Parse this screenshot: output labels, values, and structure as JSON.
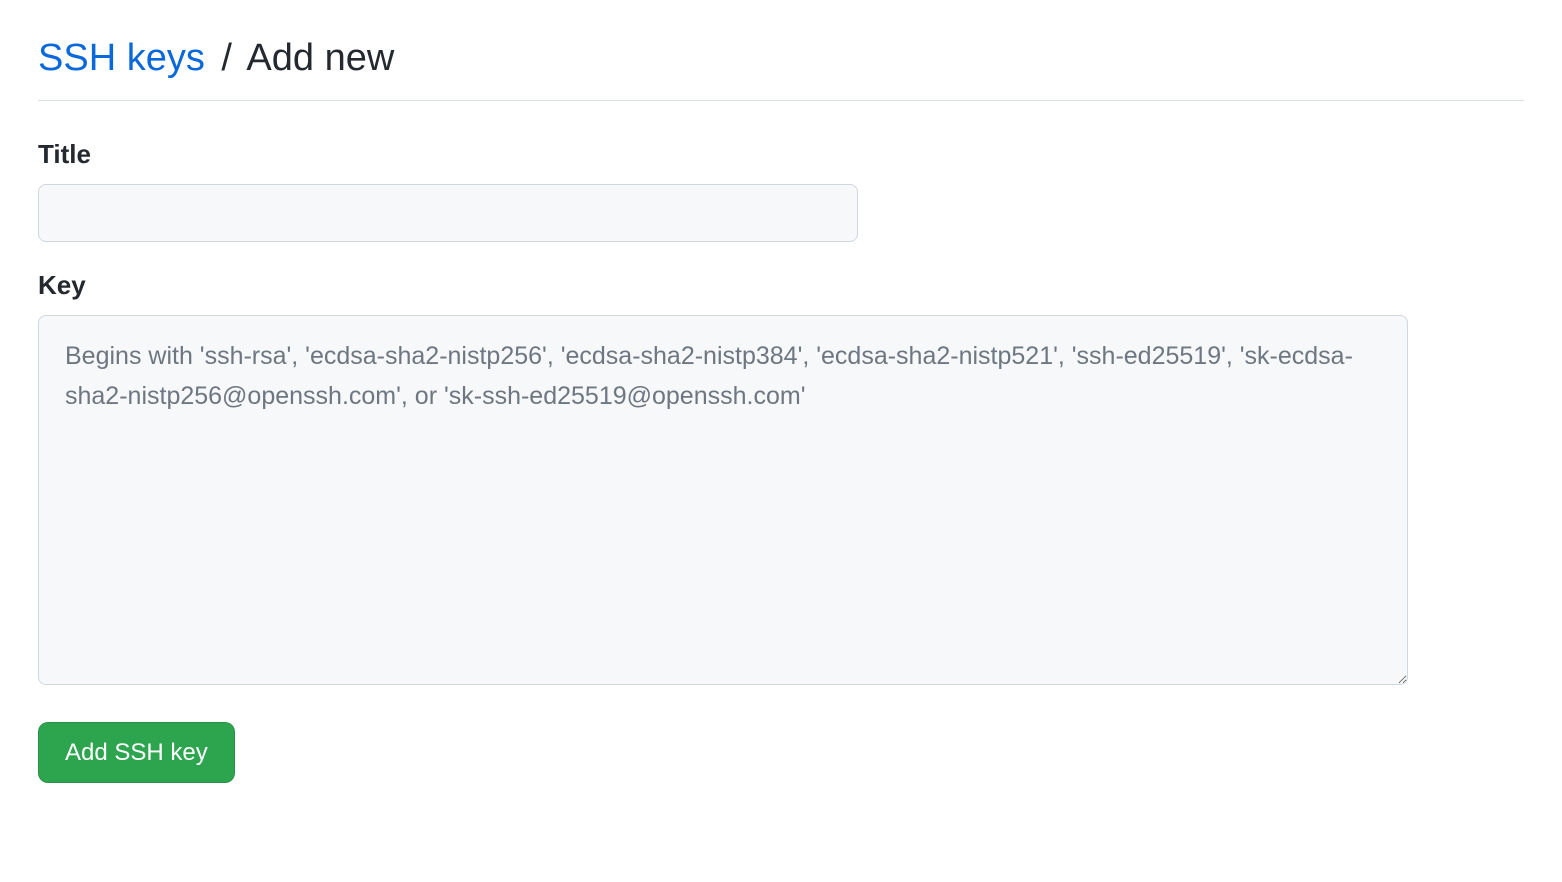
{
  "header": {
    "breadcrumb_link": "SSH keys",
    "separator": "/",
    "current": "Add new"
  },
  "form": {
    "title": {
      "label": "Title",
      "value": ""
    },
    "key": {
      "label": "Key",
      "value": "",
      "placeholder": "Begins with 'ssh-rsa', 'ecdsa-sha2-nistp256', 'ecdsa-sha2-nistp384', 'ecdsa-sha2-nistp521', 'ssh-ed25519', 'sk-ecdsa-sha2-nistp256@openssh.com', or 'sk-ssh-ed25519@openssh.com'"
    },
    "submit_label": "Add SSH key"
  }
}
